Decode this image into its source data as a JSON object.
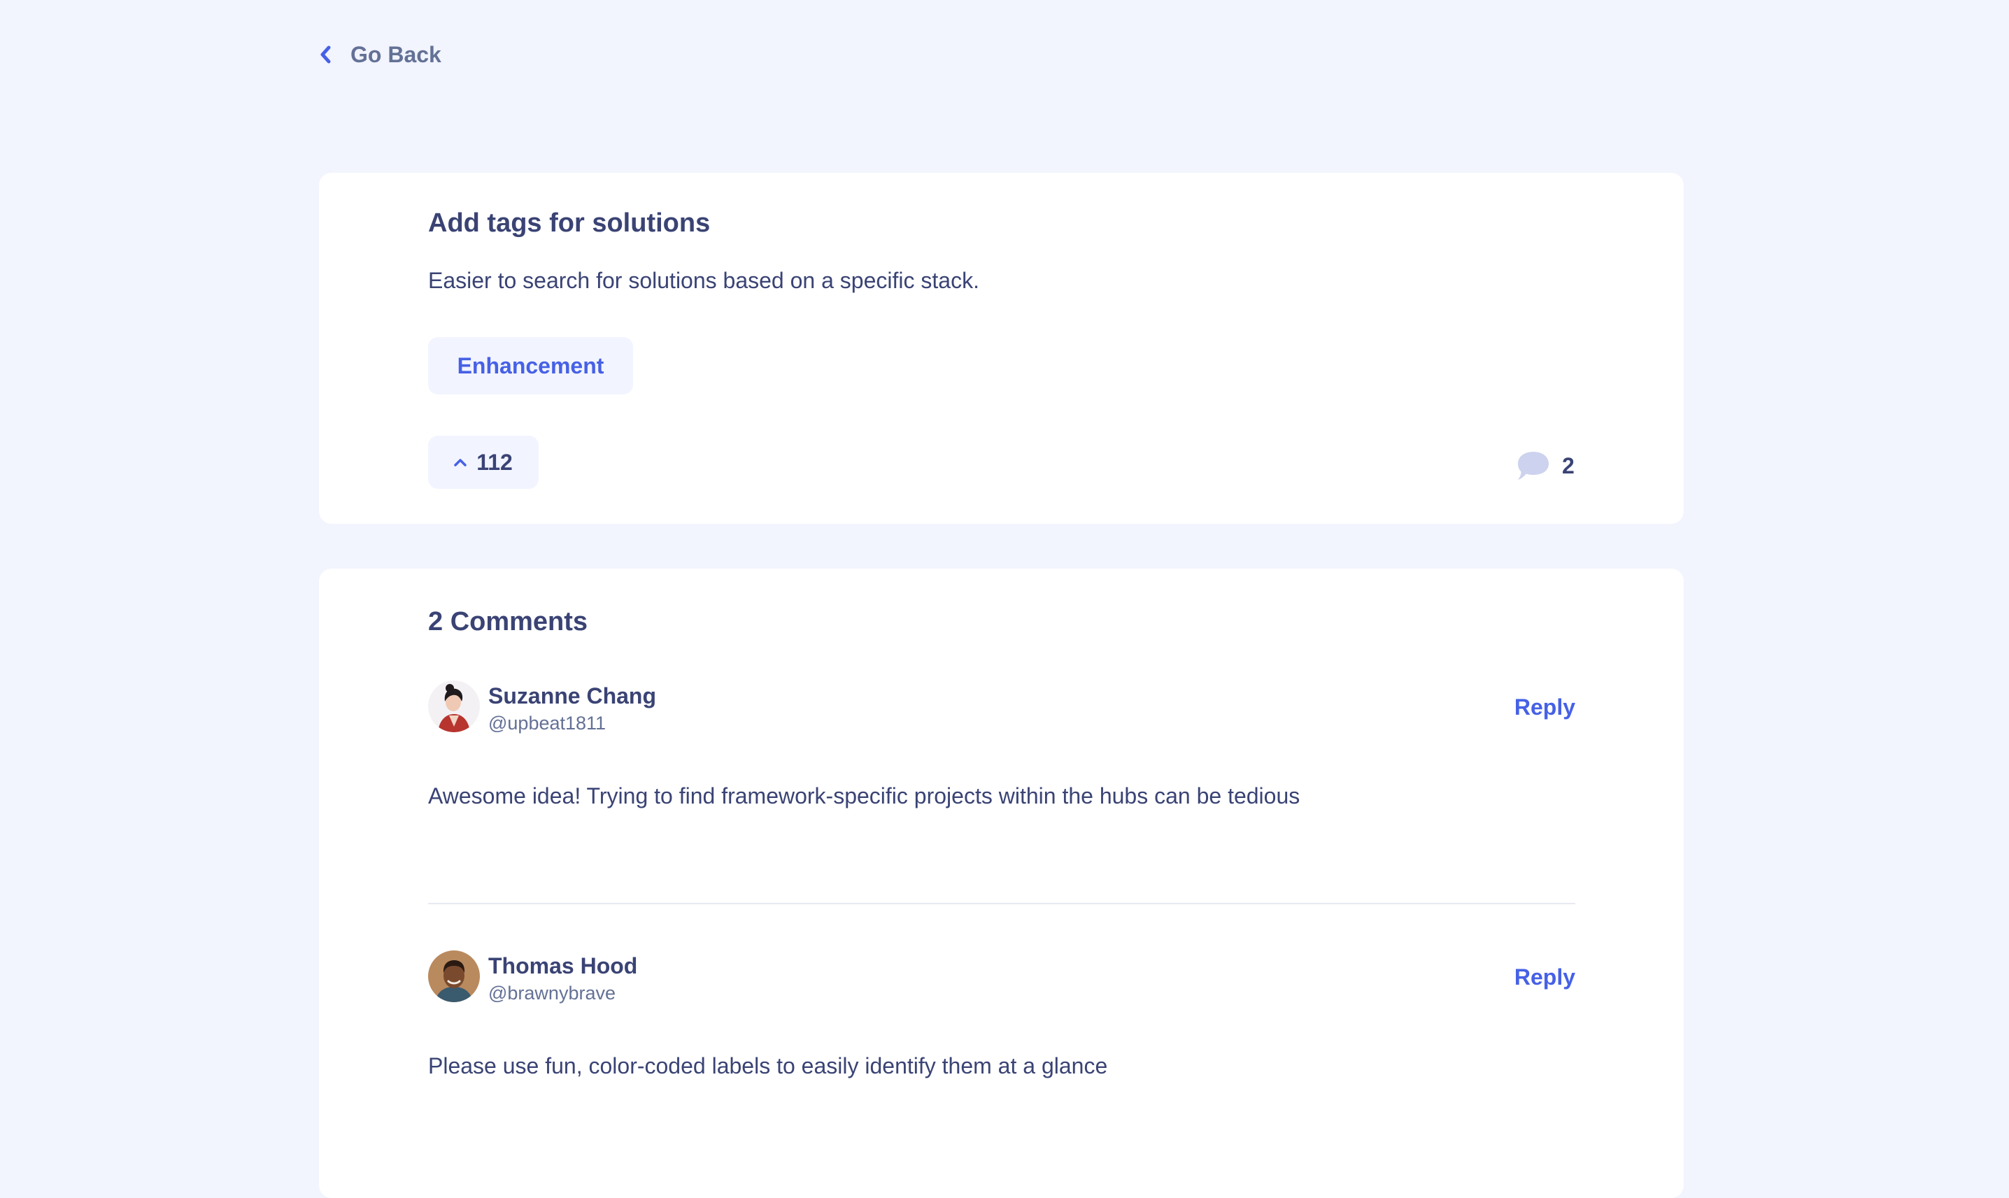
{
  "nav": {
    "back_label": "Go Back",
    "back_icon": "chevron-left-icon"
  },
  "feedback": {
    "title": "Add tags for solutions",
    "description": "Easier to search for solutions based on a specific stack.",
    "tag": "Enhancement",
    "upvotes": "112",
    "comment_count": "2"
  },
  "comments": {
    "heading": "2 Comments",
    "items": [
      {
        "name": "Suzanne Chang",
        "handle": "@upbeat1811",
        "text": "Awesome idea! Trying to find framework-specific projects within the hubs can be tedious",
        "reply_label": "Reply"
      },
      {
        "name": "Thomas Hood",
        "handle": "@brawnybrave",
        "text": "Please use fun, color-coded labels to easily identify them at a glance",
        "reply_label": "Reply"
      }
    ]
  },
  "colors": {
    "background": "#f2f4fe",
    "card": "#ffffff",
    "accent_blue": "#4661e6",
    "text_dark": "#3a4374",
    "text_muted": "#647196",
    "tag_bg": "#f2f4ff",
    "bubble": "#cdd2ee"
  }
}
